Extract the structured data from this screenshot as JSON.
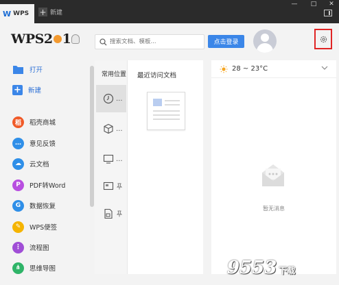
{
  "titlebar": {
    "app_tab": "WPS",
    "new_tab": "新建",
    "controls": [
      "—",
      "□",
      "✕"
    ]
  },
  "brand": {
    "text": "WPS2",
    "suffix": "1"
  },
  "sidebar": {
    "primary": [
      {
        "icon": "folder-icon",
        "label": "打开"
      },
      {
        "icon": "plus-icon",
        "label": "新建"
      }
    ],
    "items": [
      {
        "icon": "shop-icon",
        "label": "稻壳商城",
        "color": "#f05a28"
      },
      {
        "icon": "feedback-icon",
        "label": "意见反馈",
        "color": "#2f8fe8"
      },
      {
        "icon": "cloud-doc-icon",
        "label": "云文档",
        "color": "#2f8fe8"
      },
      {
        "icon": "pdf-icon",
        "label": "PDF转Word",
        "color": "#b84ee0"
      },
      {
        "icon": "recovery-icon",
        "label": "数据恢复",
        "color": "#2f8fe8"
      },
      {
        "icon": "note-icon",
        "label": "WPS便签",
        "color": "#f5b400"
      },
      {
        "icon": "flowchart-icon",
        "label": "流程图",
        "color": "#a04ed6"
      },
      {
        "icon": "mindmap-icon",
        "label": "思维导图",
        "color": "#2fb468"
      }
    ]
  },
  "topbar": {
    "search_placeholder": "搜索文档、模板...",
    "login_label": "点击登录"
  },
  "locations": {
    "title": "常用位置",
    "items": [
      {
        "icon": "clock-icon",
        "label": "..."
      },
      {
        "icon": "cube-icon",
        "label": "..."
      },
      {
        "icon": "computer-icon",
        "label": "..."
      },
      {
        "icon": "desktop-icon",
        "label": ""
      },
      {
        "icon": "document-icon",
        "label": ""
      }
    ]
  },
  "recent": {
    "title": "最近访问文档"
  },
  "weather": {
    "temperature": "28 ~ 23°C"
  },
  "messages": {
    "empty_label": "暂无消息"
  },
  "watermark": {
    "text": "9553",
    "sub": "下载"
  },
  "colors": {
    "accent": "#3b86e8",
    "titlebar": "#2b2b2b",
    "highlight": "#e02424"
  }
}
